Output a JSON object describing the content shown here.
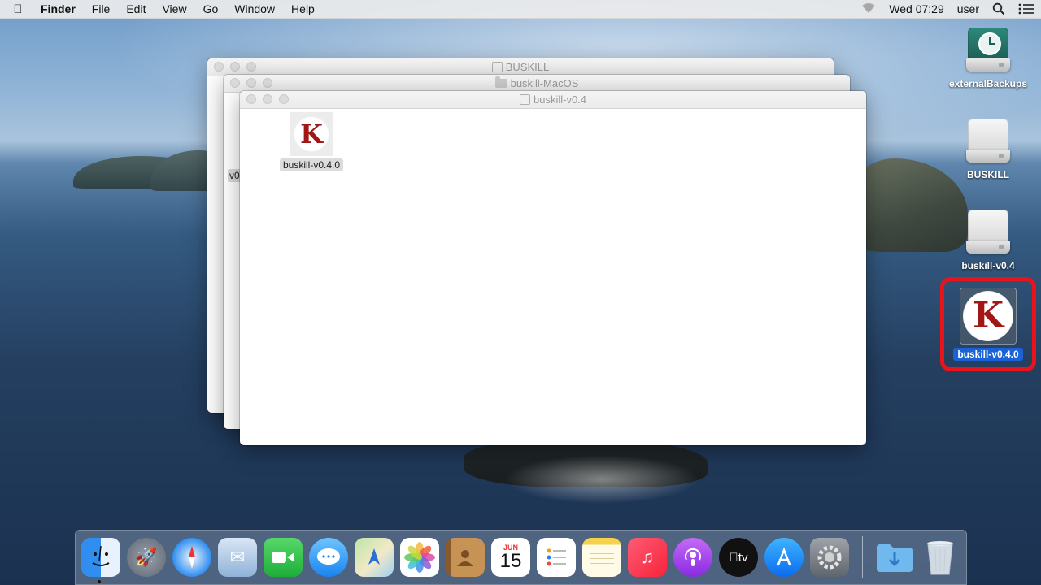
{
  "menubar": {
    "app_name": "Finder",
    "menus": [
      "File",
      "Edit",
      "View",
      "Go",
      "Window",
      "Help"
    ],
    "clock": "Wed 07:29",
    "user": "user"
  },
  "windows": {
    "back": {
      "title": "BUSKILL"
    },
    "middle": {
      "title": "buskill-MacOS",
      "stub_label": "v0"
    },
    "front": {
      "title": "buskill-v0.4",
      "file_label": "buskill-v0.4.0"
    }
  },
  "desktop": {
    "icons": [
      {
        "label": "externalBackups"
      },
      {
        "label": "BUSKILL"
      },
      {
        "label": "buskill-v0.4"
      },
      {
        "label": "buskill-v0.4.0"
      }
    ],
    "highlight_color": "#e8141b",
    "selection_color": "#1a62d6"
  },
  "dock": {
    "calendar_month": "JUN",
    "calendar_day": "15",
    "tv_label": "tv"
  }
}
